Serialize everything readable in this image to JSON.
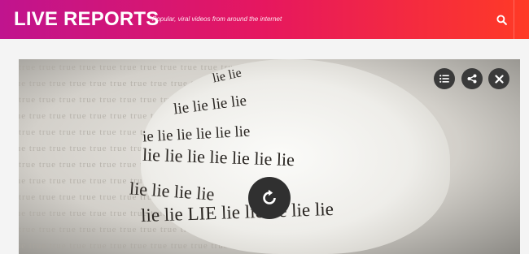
{
  "header": {
    "brand": "LIVE REPORTS",
    "tagline": "Popular, viral videos from around the internet",
    "search_icon": "search-icon",
    "gradient": [
      "#c0148e",
      "#e6175f",
      "#ff3a26"
    ]
  },
  "video": {
    "controls": [
      {
        "name": "playlist-button",
        "icon": "playlist-icon"
      },
      {
        "name": "share-button",
        "icon": "share-icon"
      },
      {
        "name": "close-button",
        "icon": "close-icon"
      }
    ],
    "replay_icon": "replay-icon",
    "thumbnail": {
      "lines": [
        "lie lie",
        "lie lie lie lie",
        "ie lie lie lie lie lie",
        "lie lie lie lie lie lie lie",
        "lie lie lie lie",
        "lie lie LIE lie lie lie lie lie"
      ],
      "background_words": [
        "true true true true true true true true true true true true true",
        "true true true true true true true true true true true true true",
        "true true true true true true true true true true true true true",
        "true true true true true true true true true true true true true",
        "true true true true true true true true true true true true true",
        "true true true true true true true true true true true true true",
        "true true true true true true true true true true true true true",
        "true true true true true true true true true true true true true",
        "true true true true true true true true true true true true true",
        "true true true true true true true true true true true true true",
        "true true true true true true true true true true true true true",
        "true true true true true true true true true true true true true"
      ]
    }
  }
}
